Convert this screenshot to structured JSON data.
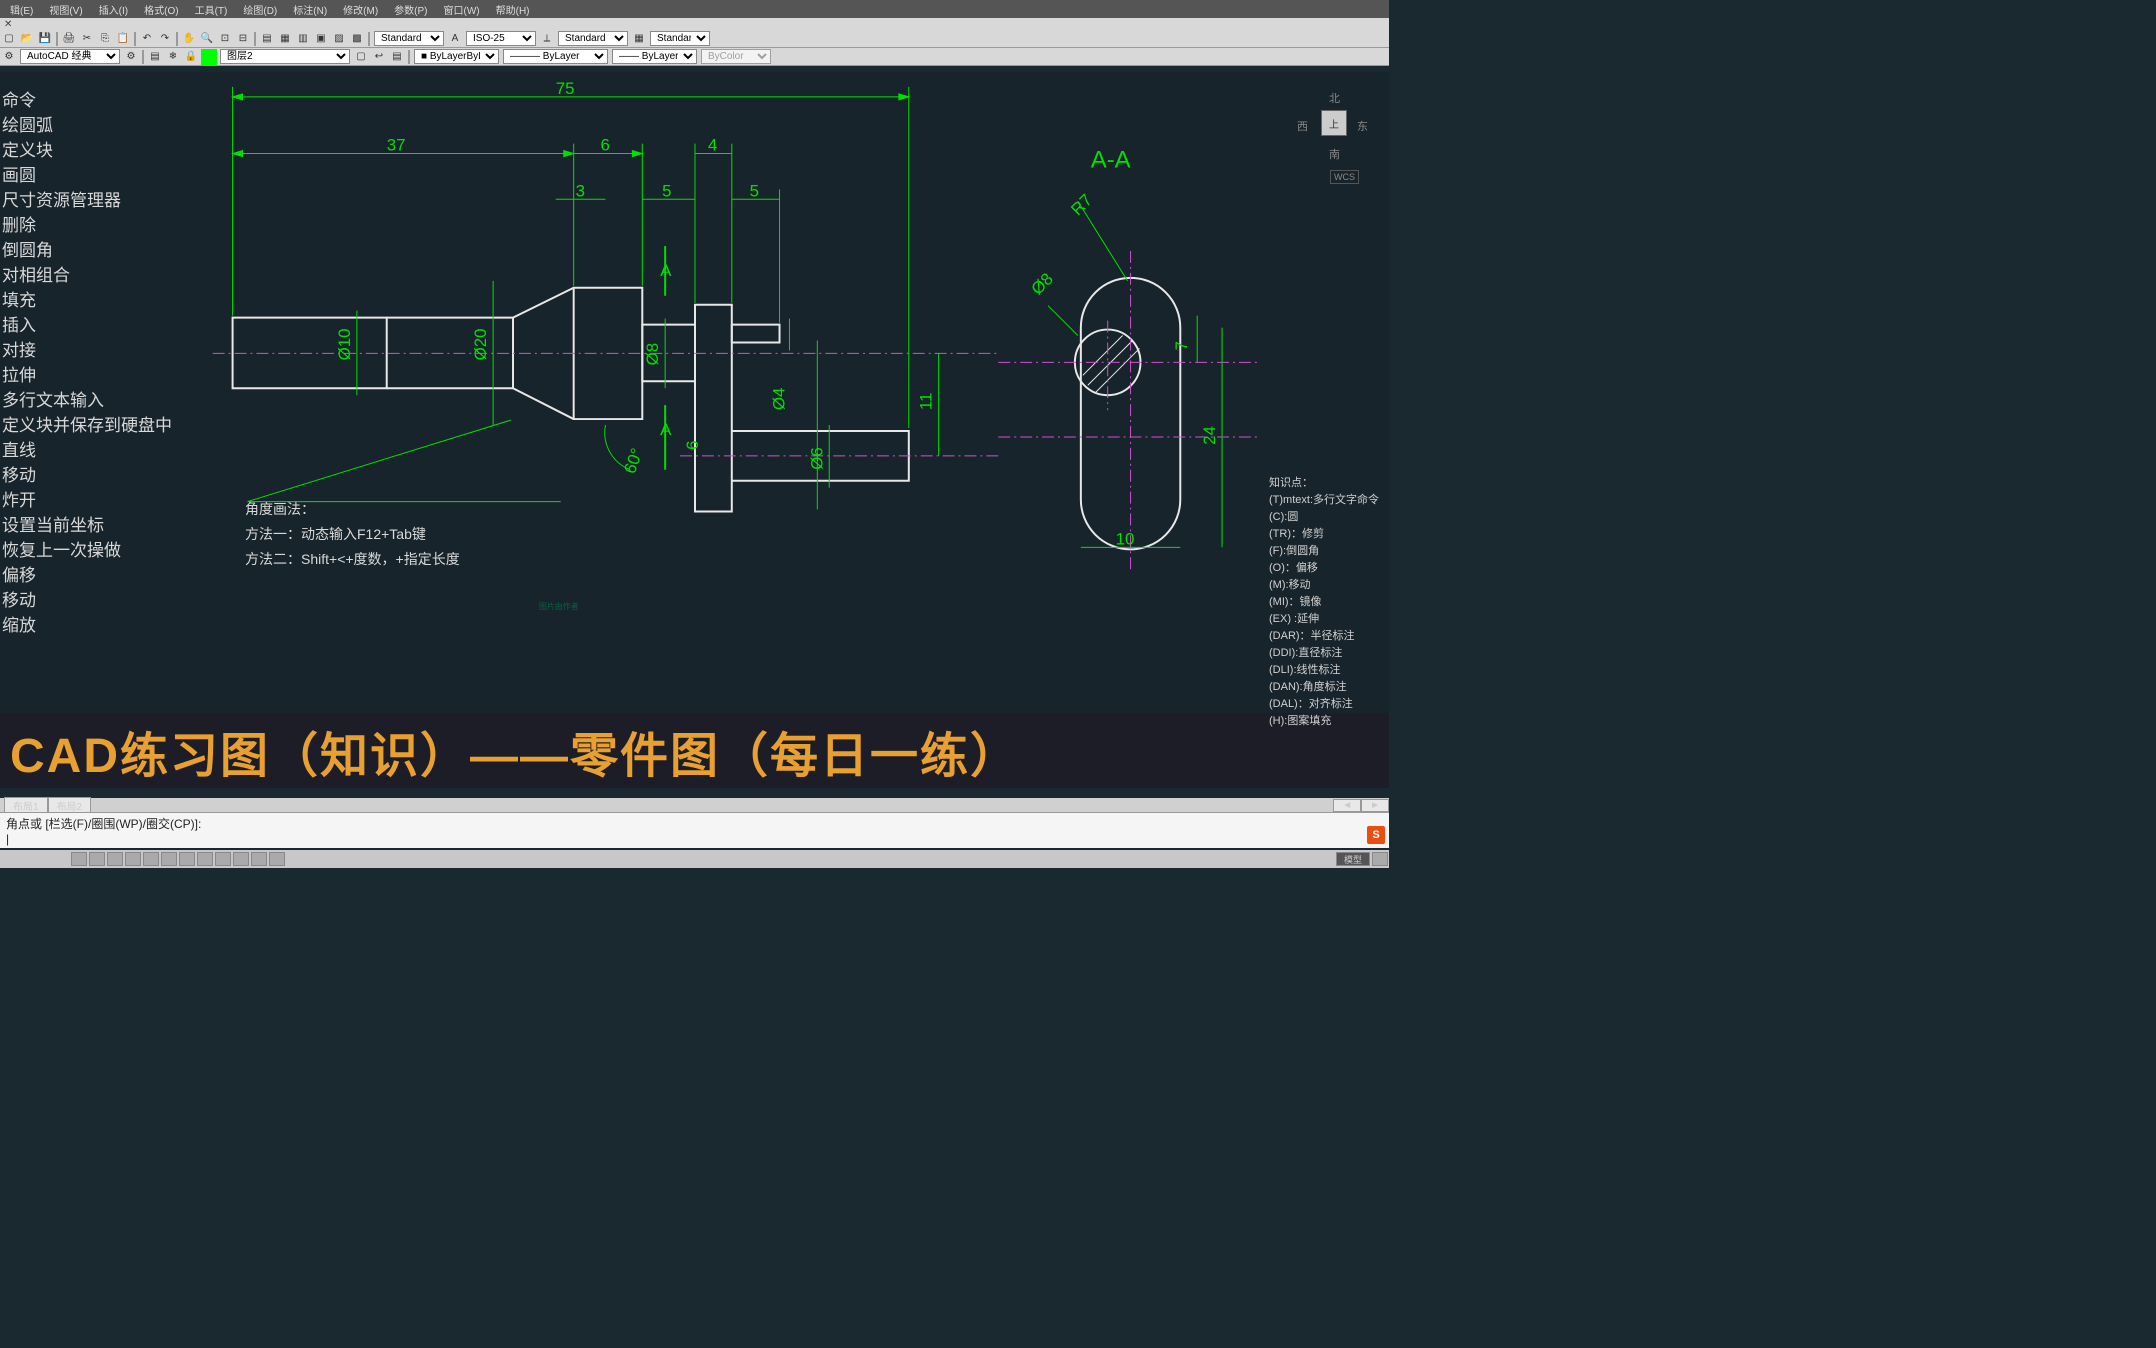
{
  "menu": {
    "items": [
      "辑(E)",
      "视图(V)",
      "插入(I)",
      "格式(O)",
      "工具(T)",
      "绘图(D)",
      "标注(N)",
      "修改(M)",
      "参数(P)",
      "窗口(W)",
      "帮助(H)"
    ],
    "close": "✕"
  },
  "toolbars": {
    "styles": [
      "Standard",
      "ISO-25",
      "Standard",
      "Standard"
    ],
    "workspace": "AutoCAD 经典",
    "layer": "图层2",
    "bylayer1": "ByLayer",
    "bylayer2": "ByLayer",
    "bylayer3": "ByLayer",
    "bycolor": "ByColor"
  },
  "commands": {
    "list": [
      "命令",
      "绘圆弧",
      "定义块",
      "画圆",
      "尺寸资源管理器",
      "删除",
      "倒圆角",
      "对相组合",
      "填充",
      "插入",
      "对接",
      "拉伸",
      "多行文本输入",
      "定义块并保存到硬盘中",
      "直线",
      "移动",
      "炸开",
      "设置当前坐标",
      "恢复上一次操做",
      "偏移",
      "移动",
      "缩放"
    ]
  },
  "viewcube": {
    "n": "北",
    "s": "南",
    "e": "东",
    "w": "西",
    "top": "上",
    "wcs": "WCS"
  },
  "drawing": {
    "dims": {
      "d75": "75",
      "d37": "37",
      "d6": "6",
      "d4": "4",
      "d3": "3",
      "d5a": "5",
      "d5b": "5",
      "dia10": "Ø10",
      "dia20": "Ø20",
      "dia8": "Ø8",
      "dia4": "Ø4",
      "dia6": "Ø6",
      "h11": "11",
      "h6": "6",
      "ang60": "60°",
      "sectA": "A",
      "sectAA": "A-A",
      "r7": "R7",
      "dia8b": "Ø8",
      "h7": "7",
      "h24": "24",
      "w10": "10"
    },
    "watermark": "图片由作者"
  },
  "angle_note": {
    "title": "角度画法：",
    "line1": "方法一：动态输入F12+Tab键",
    "line2": "方法二：Shift+<+度数，+指定长度"
  },
  "knowledge": {
    "title": "知识点：",
    "items": [
      "(T)mtext:多行文字命令",
      "(C):圆",
      "(TR)：修剪",
      "(F):倒圆角",
      "(O)：偏移",
      "(M):移动",
      "(MI)：镜像",
      "(EX) :延伸",
      "(DAR)：半径标注",
      "(DDI):直径标注",
      "(DLI):线性标注",
      "(DAN):角度标注",
      "(DAL)：对齐标注",
      "(H):图案填充"
    ]
  },
  "title_overlay": "CAD练习图（知识）——零件图（每日一练）",
  "layout_tabs": [
    "布局1",
    "布局2"
  ],
  "cmdline": {
    "prompt": "角点或 [栏选(F)/圈围(WP)/圈交(CP)]:",
    "cursor": "|"
  },
  "ime": "S"
}
